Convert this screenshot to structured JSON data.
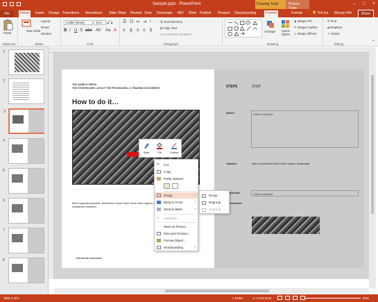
{
  "window": {
    "title": "Sample.pptx - PowerPoint",
    "context_drawing": "Drawing Tools",
    "context_picture": "Picture Tools",
    "controls": [
      "–",
      "□",
      "×"
    ]
  },
  "tabs": [
    "File",
    "Home",
    "Insert",
    "Design",
    "Transitions",
    "Animations",
    "Slide Show",
    "Review",
    "View",
    "Developer",
    "MIX",
    "Write",
    "Publish",
    "Present",
    "Storyboarding",
    "Format",
    "Format"
  ],
  "tell_me": "Tell me",
  "user": "Murray Fife",
  "share": "Share",
  "ribbon": {
    "clipboard": {
      "paste": "Paste",
      "label": "Clipboard"
    },
    "slides": {
      "new_slide": "New Slide",
      "layout": "Layout",
      "reset": "Reset",
      "section": "Section",
      "label": "Slides"
    },
    "font": {
      "name": "Calibri (Body)",
      "size": "10.5",
      "label": "Font"
    },
    "paragraph": {
      "text_direction": "Text Direction",
      "align_text": "Align Text",
      "convert_smartart": "Convert to SmartArt",
      "label": "Paragraph"
    },
    "drawing": {
      "arrange": "Arrange",
      "quick_styles": "Quick Styles",
      "shape_fill": "Shape Fill",
      "shape_outline": "Shape Outline",
      "shape_effects": "Shape Effects",
      "label": "Drawing"
    },
    "editing": {
      "find": "Find",
      "replace": "Replace",
      "select": "Select",
      "label": "Editing"
    }
  },
  "thumbnails": [
    "1",
    "2",
    "3",
    "4",
    "5",
    "6",
    "7",
    "8"
  ],
  "slide": {
    "header_line1": "THE SAMPLE PRESS",
    "header_line2": "THE STORYBOARD LAYOUT FOR PROCEDURAL & TRAINING DOCUMENTS",
    "title": "How to do it…",
    "caption": "Beef capicola pancetta, tenderloin corned beef doner filet mignon landjaeger frankfurter pastrami.",
    "steps_label": "STEPS",
    "step_label": "STEP",
    "notes_label": "Notes:",
    "notes_placeholder": "Click to add text",
    "caption_label": "Caption:",
    "caption_value": "tavin corned beef doner filet mignon landjaeger",
    "keywords_label": "Keywords:",
    "keywords_placeholder": "Click to add text",
    "screenshot_label": "Screenshot:",
    "footer_logo": "TRIP MOOSE PUBLISHING"
  },
  "mini_toolbar": {
    "style": "Style",
    "fill": "Fill",
    "outline": "Outline"
  },
  "context_menu": {
    "cut": "Cut",
    "copy": "Copy",
    "paste_options": "Paste Options:",
    "group": "Group",
    "bring_front": "Bring to Front",
    "send_back": "Send to Back",
    "hyperlink": "Hyperlink...",
    "save_picture": "Save as Picture...",
    "size_position": "Size and Position...",
    "format_object": "Format Object...",
    "storyboarding": "Storyboarding"
  },
  "submenu": {
    "group": "Group",
    "regroup": "Regroup",
    "ungroup": "Ungroup"
  },
  "status": {
    "slide": "Slide 3 of 6",
    "notes": "Notes",
    "comments": "Comments",
    "zoom": "64%"
  },
  "colors": {
    "accent": "#c43e1c",
    "highlight": "#f9d9cc"
  }
}
